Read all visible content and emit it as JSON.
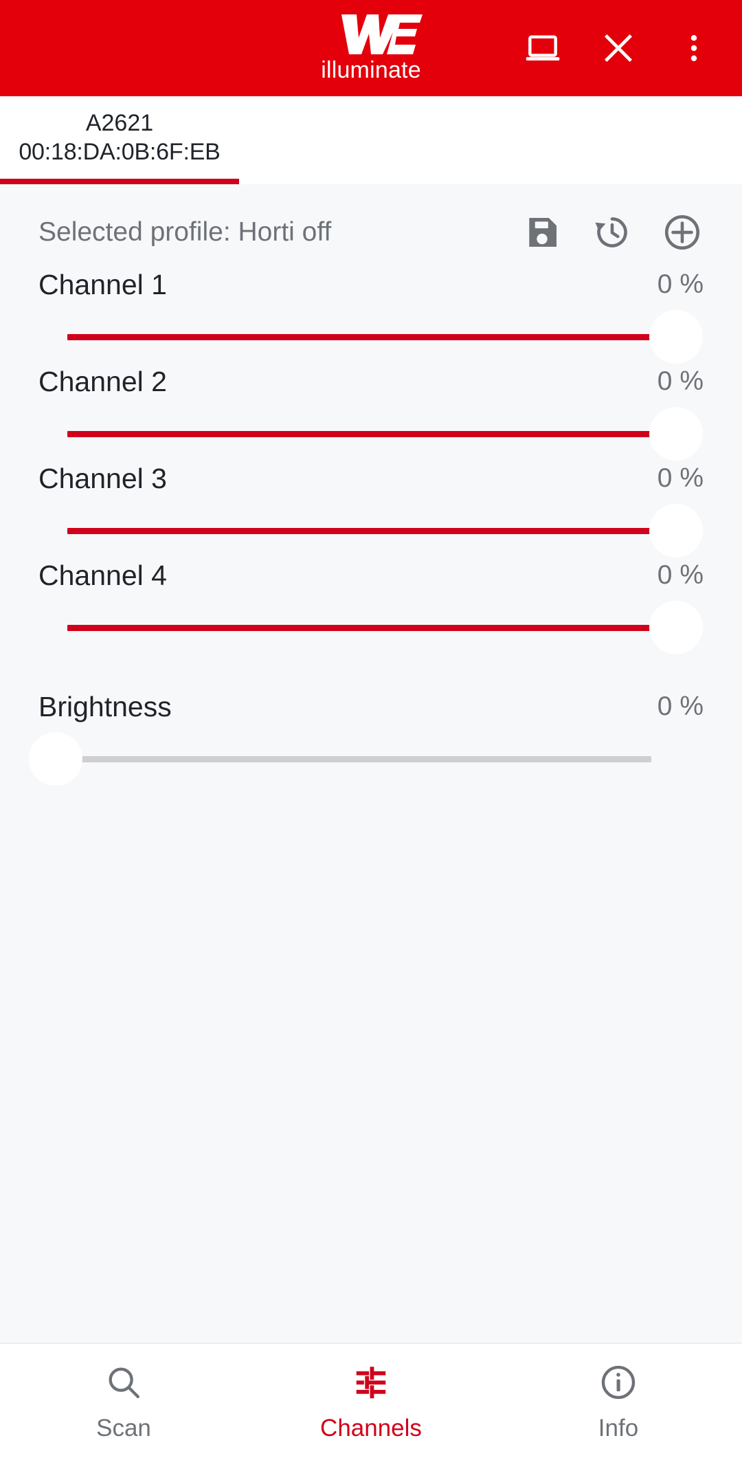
{
  "theme": {
    "brand_red": "#E3000B",
    "accent_red": "#D0021B",
    "bg": "#F7F8FA",
    "surface": "#FFFFFF",
    "text_primary": "#20242A",
    "text_secondary": "#6E7277",
    "track_grey": "#CFCFCF"
  },
  "appbar": {
    "brand_mark": "WE",
    "brand_subtitle": "illuminate",
    "actions": [
      {
        "name": "laptop-icon",
        "label": "Connect to PC"
      },
      {
        "name": "close-icon",
        "label": "Disconnect"
      },
      {
        "name": "more-vert-icon",
        "label": "More options"
      }
    ]
  },
  "device_tab": {
    "name": "A2621",
    "mac": "00:18:DA:0B:6F:EB",
    "selected": true
  },
  "profile": {
    "label": "Selected profile: Horti off",
    "profile_name": "Horti off",
    "actions": [
      {
        "name": "save-icon",
        "label": "Save profile"
      },
      {
        "name": "history-icon",
        "label": "Profile history"
      },
      {
        "name": "add-icon",
        "label": "Add profile"
      }
    ]
  },
  "channels": [
    {
      "label": "Channel 1",
      "value": 0,
      "value_text": "0 %"
    },
    {
      "label": "Channel 2",
      "value": 0,
      "value_text": "0 %"
    },
    {
      "label": "Channel 3",
      "value": 0,
      "value_text": "0 %"
    },
    {
      "label": "Channel 4",
      "value": 0,
      "value_text": "0 %"
    }
  ],
  "brightness": {
    "label": "Brightness",
    "value": 0,
    "value_text": "0 %"
  },
  "bottom_nav": {
    "items": [
      {
        "label": "Scan",
        "icon": "search-icon",
        "active": false
      },
      {
        "label": "Channels",
        "icon": "tune-icon",
        "active": true
      },
      {
        "label": "Info",
        "icon": "info-icon",
        "active": false
      }
    ]
  }
}
